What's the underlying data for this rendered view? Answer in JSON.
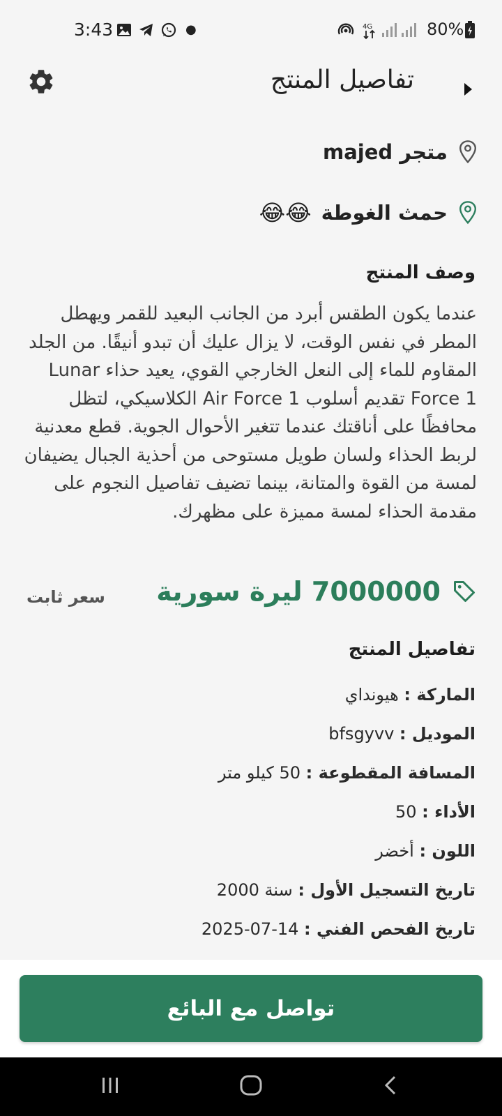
{
  "status_bar": {
    "time": "3:43",
    "battery": "80%"
  },
  "header": {
    "title": "تفاصيل المنتج"
  },
  "store": {
    "name": "متجر majed",
    "location": "حمث الغوطة",
    "location_emoji": "😂😂"
  },
  "description": {
    "title": "وصف المنتج",
    "text": "عندما يكون الطقس أبرد من الجانب البعيد للقمر ويهطل المطر في نفس الوقت، لا يزال عليك أن تبدو أنيقًا. من الجلد المقاوم للماء إلى النعل الخارجي القوي، يعيد حذاء Lunar Force 1 تقديم أسلوب Air Force 1 الكلاسيكي، لتظل محافظًا على أناقتك عندما تتغير الأحوال الجوية. قطع معدنية لربط الحذاء ولسان طويل مستوحى من أحذية الجبال يضيفان لمسة من القوة والمتانة، بينما تضيف تفاصيل النجوم على مقدمة الحذاء لمسة مميزة على مظهرك."
  },
  "price": {
    "value": "7000000 ليرة سورية",
    "type": "سعر ثابت"
  },
  "details": {
    "title": "تفاصيل المنتج",
    "items": [
      {
        "label": "الماركة :",
        "value": "هيونداي"
      },
      {
        "label": "الموديل :",
        "value": "bfsgyvv"
      },
      {
        "label": "المسافة المقطوعة :",
        "value": "50 كيلو متر"
      },
      {
        "label": "الأداء :",
        "value": "50"
      },
      {
        "label": "اللون :",
        "value": "أخضر"
      },
      {
        "label": "تاريخ التسجيل الأول :",
        "value": "سنة 2000"
      },
      {
        "label": "تاريخ الفحص الفني :",
        "value": "14-07-2025"
      }
    ]
  },
  "contact_button": {
    "label": "تواصل مع البائع"
  },
  "colors": {
    "accent": "#2d7f5e",
    "price": "#2c7e5b",
    "background": "#f5f5f5"
  }
}
